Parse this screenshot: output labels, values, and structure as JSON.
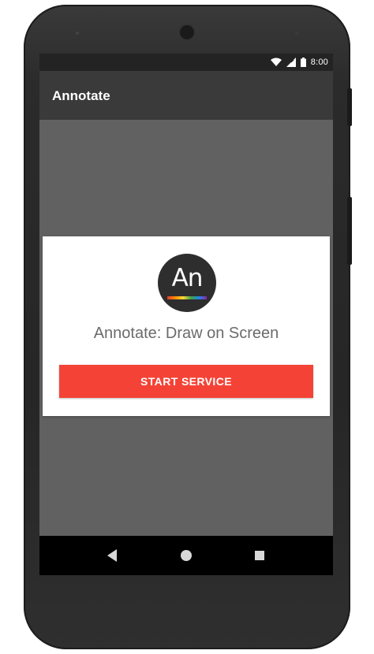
{
  "status_bar": {
    "time": "8:00",
    "icons": [
      "wifi-icon",
      "signal-icon",
      "battery-icon"
    ]
  },
  "app_bar": {
    "title": "Annotate"
  },
  "card": {
    "logo_text": "An",
    "title": "Annotate: Draw on Screen",
    "button_label": "START SERVICE"
  },
  "nav_bar": {
    "icons": [
      "back-icon",
      "home-icon",
      "recents-icon"
    ]
  },
  "colors": {
    "accent": "#f44336",
    "app_bar": "#3a3a3a",
    "screen_background": "#616161",
    "card": "#ffffff"
  }
}
